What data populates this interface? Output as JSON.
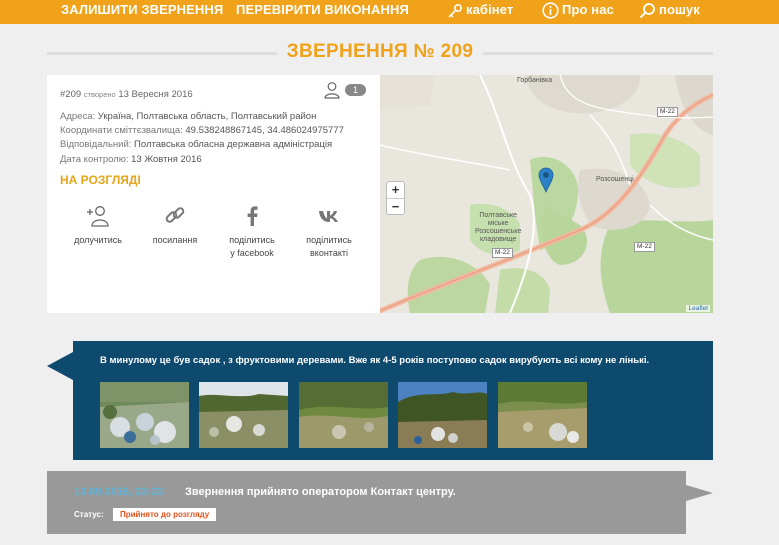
{
  "nav": {
    "submit": "ЗАЛИШИТИ ЗВЕРНЕННЯ",
    "check": "ПЕРЕВІРИТИ ВИКОНАННЯ",
    "cabinet": "кабінет",
    "about": "Про нас",
    "search": "пошук"
  },
  "page": {
    "title": "ЗВЕРНЕННЯ № 209"
  },
  "request": {
    "id": "#209",
    "created_label": "створено",
    "created_date": "13 Вересня 2016",
    "followers": "1",
    "address_label": "Адреса:",
    "address": "Україна, Полтавська область, Полтавський район",
    "coords_label": "Координати сміттєзвалища:",
    "coords": "49.538248867145, 34.486024975777",
    "responsible_label": "Відповідальний:",
    "responsible": "Полтавська обласна державна адміністрація",
    "control_label": "Дата контролю:",
    "control_date": "13 Жовтня 2016",
    "status": "НА РОЗГЛЯДІ"
  },
  "actions": {
    "join": "долучитись",
    "link": "посилання",
    "facebook_1": "поділитись",
    "facebook_2": "у facebook",
    "vk_1": "поділитись",
    "vk_2": "вконтакті"
  },
  "map": {
    "village_1": "Горбанівка",
    "village_2": "Розсошенці",
    "cemetery_1": "Полтавське",
    "cemetery_2": "міське",
    "cemetery_3": "Розсошенське",
    "cemetery_4": "кладовище",
    "road_1": "М-22",
    "road_2": "М-22",
    "road_3": "М-22",
    "zoom_in": "+",
    "zoom_out": "−",
    "attribution": "Leaflet"
  },
  "description": {
    "text": "В минулому це був садок , з фруктовими деревами. Вже як 4-5 років поступово садок вирубують всі кому не лінькі."
  },
  "history": {
    "datetime": "13.09.2016, 23:23",
    "message": "Звернення прийнято оператором Контакт центру.",
    "status_label": "Статус:",
    "status": "Прийнято до розгляду"
  },
  "colors": {
    "accent": "#f0a21a",
    "banner": "#0e4a6e",
    "history": "#999999",
    "status_red": "#e8521f"
  }
}
